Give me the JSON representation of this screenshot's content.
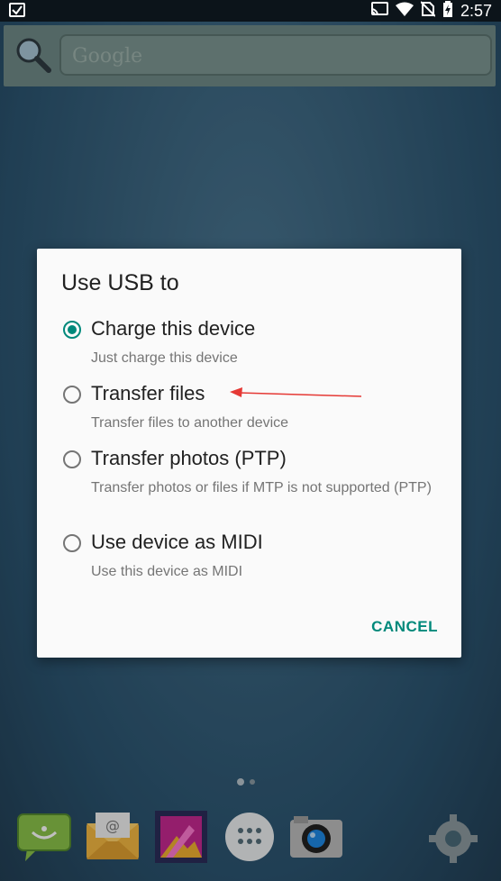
{
  "status_bar": {
    "time": "2:57",
    "icons": [
      "task-done-icon",
      "cast-icon",
      "wifi-icon",
      "no-sim-icon",
      "battery-icon"
    ]
  },
  "search_widget": {
    "placeholder": "Google"
  },
  "dialog": {
    "title": "Use USB to",
    "options": [
      {
        "label": "Charge this device",
        "description": "Just charge this device",
        "selected": true
      },
      {
        "label": "Transfer files",
        "description": "Transfer files to another device",
        "selected": false
      },
      {
        "label": "Transfer photos (PTP)",
        "description": "Transfer photos or files if MTP is not supported (PTP)",
        "selected": false
      },
      {
        "label": "Use device as MIDI",
        "description": "Use this device as MIDI",
        "selected": false
      }
    ],
    "cancel_label": "CANCEL"
  },
  "colors": {
    "accent": "#00897b",
    "annotation_arrow": "#e53935"
  },
  "dock": {
    "apps": [
      "messaging-icon",
      "email-icon",
      "gallery-icon",
      "app-drawer-icon",
      "camera-icon",
      "settings-icon"
    ]
  }
}
